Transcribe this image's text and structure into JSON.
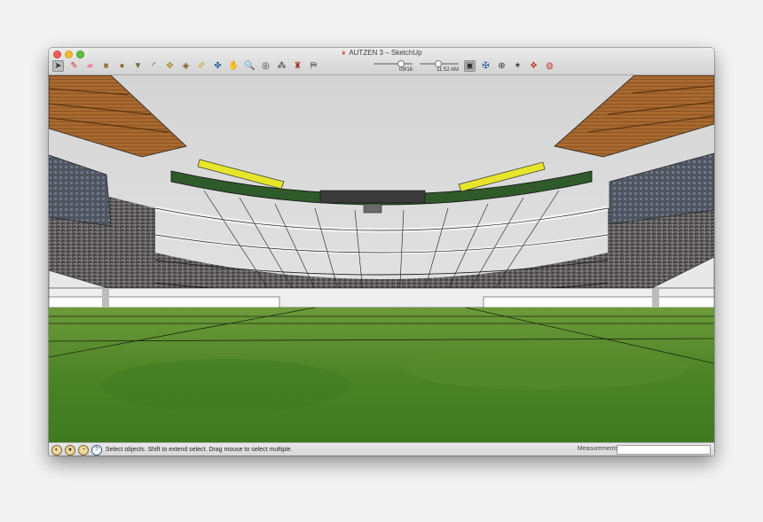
{
  "window": {
    "title": "AUTZEN 3 – SketchUp"
  },
  "toolbar": {
    "tools": [
      {
        "name": "select-tool",
        "glyph": "➤",
        "selected": true
      },
      {
        "name": "pencil-line-tool",
        "glyph": "✎",
        "color": "#c0392b"
      },
      {
        "name": "eraser-tool",
        "glyph": "▰",
        "color": "#e68aa8"
      },
      {
        "name": "rectangle-tool",
        "glyph": "■",
        "color": "#9a7a4a"
      },
      {
        "name": "circle-tool",
        "glyph": "●",
        "color": "#8a6a3a"
      },
      {
        "name": "push-pull-tool",
        "glyph": "▼",
        "color": "#7a6a4a"
      },
      {
        "name": "arc-tool",
        "glyph": "◜",
        "color": "#444"
      },
      {
        "name": "move-tool",
        "glyph": "✥",
        "color": "#b08a2a"
      },
      {
        "name": "paint-bucket-tool",
        "glyph": "◈",
        "color": "#7a5a2a"
      },
      {
        "name": "tape-measure-tool",
        "glyph": "✐",
        "color": "#d0a020"
      },
      {
        "name": "orbit-tool",
        "glyph": "✤",
        "color": "#2a5fa0"
      },
      {
        "name": "pan-tool",
        "glyph": "✋",
        "color": "#555"
      },
      {
        "name": "zoom-tool",
        "glyph": "🔍",
        "color": "#333"
      },
      {
        "name": "zoom-extents-tool",
        "glyph": "◎",
        "color": "#333"
      },
      {
        "name": "walk-tool",
        "glyph": "⁂",
        "color": "#333"
      },
      {
        "name": "position-camera-tool",
        "glyph": "♜",
        "color": "#a03020"
      },
      {
        "name": "shadows-toggle",
        "glyph": "⛿",
        "color": "#333"
      }
    ],
    "right_tools": [
      {
        "name": "style-toggle",
        "glyph": "▣",
        "color": "#333",
        "selected": true
      },
      {
        "name": "fog-toggle",
        "glyph": "✠",
        "color": "#2a5fa0"
      },
      {
        "name": "look-around-tool",
        "glyph": "⊕",
        "color": "#333"
      },
      {
        "name": "section-plane-tool",
        "glyph": "✶",
        "color": "#333"
      },
      {
        "name": "component-tool",
        "glyph": "❖",
        "color": "#c03a2a"
      },
      {
        "name": "extension-warehouse-tool",
        "glyph": "◍",
        "color": "#c03a2a"
      }
    ],
    "date_slider": {
      "label": "09/16",
      "value": 0.7
    },
    "time_slider": {
      "label": "11:52 AM",
      "value": 0.45
    }
  },
  "status": {
    "hint": "Select objects. Shift to extend select. Drag mouse to select multiple.",
    "measurements_label": "Measurements",
    "measurements_value": ""
  },
  "colors": {
    "sky": "#dcdcdc",
    "field": "#4f8a2a",
    "roof_wood": "#a86a34",
    "accent_yellow": "#e7e52a",
    "accent_green": "#2f5a2a"
  }
}
